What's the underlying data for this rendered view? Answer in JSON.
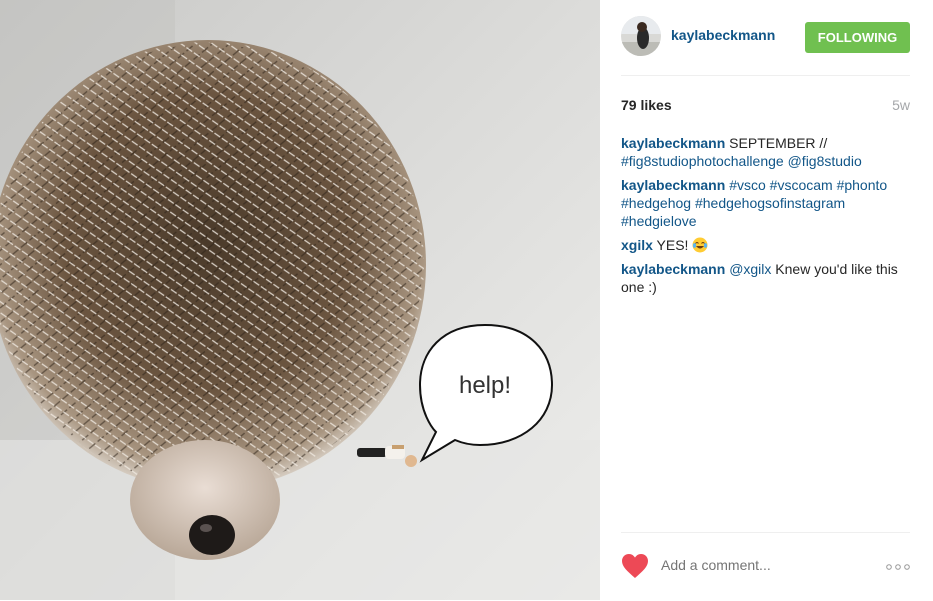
{
  "post": {
    "username": "kaylabeckmann",
    "follow_label": "FOLLOWING",
    "likes": "79 likes",
    "age": "5w",
    "photo_caption_bubble": "help!"
  },
  "comments": [
    {
      "user": "kaylabeckmann",
      "parts": [
        {
          "t": "text",
          "v": " SEPTEMBER // "
        },
        {
          "t": "tag",
          "v": "#fig8studiophotochallenge"
        },
        {
          "t": "text",
          "v": " "
        },
        {
          "t": "tag",
          "v": "@fig8studio"
        }
      ]
    },
    {
      "user": "kaylabeckmann",
      "parts": [
        {
          "t": "text",
          "v": " "
        },
        {
          "t": "tag",
          "v": "#vsco"
        },
        {
          "t": "text",
          "v": " "
        },
        {
          "t": "tag",
          "v": "#vscocam"
        },
        {
          "t": "text",
          "v": " "
        },
        {
          "t": "tag",
          "v": "#phonto"
        },
        {
          "t": "text",
          "v": " "
        },
        {
          "t": "tag",
          "v": "#hedgehog"
        },
        {
          "t": "text",
          "v": " "
        },
        {
          "t": "tag",
          "v": "#hedgehogsofinstagram"
        },
        {
          "t": "text",
          "v": " "
        },
        {
          "t": "tag",
          "v": "#hedgielove"
        }
      ]
    },
    {
      "user": "xgilx",
      "parts": [
        {
          "t": "text",
          "v": " YES! "
        },
        {
          "t": "emoji",
          "v": "tears-of-joy-emoji"
        }
      ]
    },
    {
      "user": "kaylabeckmann",
      "parts": [
        {
          "t": "text",
          "v": " "
        },
        {
          "t": "tag",
          "v": "@xgilx"
        },
        {
          "t": "text",
          "v": " Knew you'd like this one :)"
        }
      ]
    }
  ],
  "footer": {
    "comment_placeholder": "Add a comment...",
    "heart_icon": "heart-icon",
    "more_icon": "more-options-icon"
  },
  "colors": {
    "link": "#125688",
    "follow_bg": "#70c050",
    "heart": "#ed4956",
    "muted": "#a5a7aa"
  }
}
